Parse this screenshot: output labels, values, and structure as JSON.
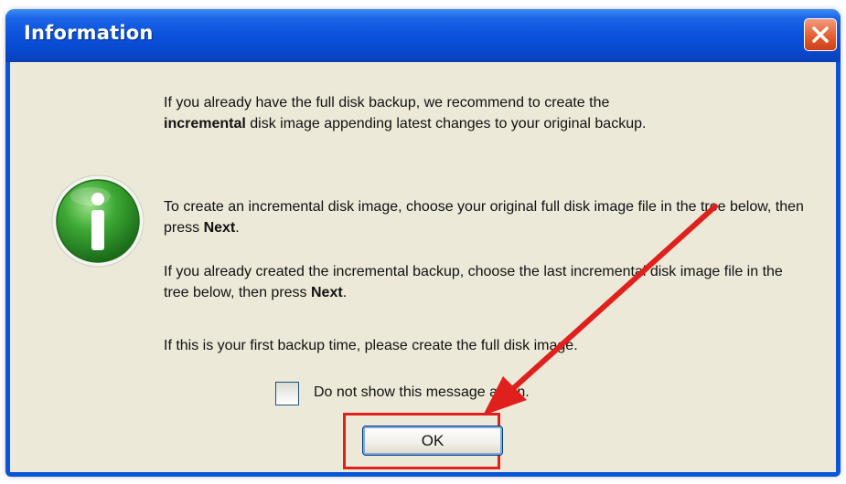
{
  "dialog": {
    "title": "Information",
    "paragraphs": {
      "p1_a": "If you already have the full disk backup, we recommend to create the",
      "p1_bold": "incremental",
      "p1_b": "disk image appending latest changes to your original backup.",
      "p2_a": "To create an incremental disk image, choose your original full disk image file in the tree below, then press",
      "p2_bold": "Next",
      "p2_end": ".",
      "p3_a": "If you already created the incremental backup, choose the last incremental disk image file in the tree below, then press",
      "p3_bold": "Next",
      "p3_end": ".",
      "p4": "If this is your first backup time, please create the full disk image."
    },
    "checkbox_label": "Do not show this message again.",
    "checkbox_checked": false,
    "ok_label": "OK"
  },
  "icons": {
    "dialog": "info-icon",
    "close": "close-icon"
  },
  "colors": {
    "titlebar": "#0a52dc",
    "client": "#ece9d8",
    "close_button": "#e45a2a",
    "info_icon": "#2e9a2a",
    "annotation": "#e0201c"
  }
}
